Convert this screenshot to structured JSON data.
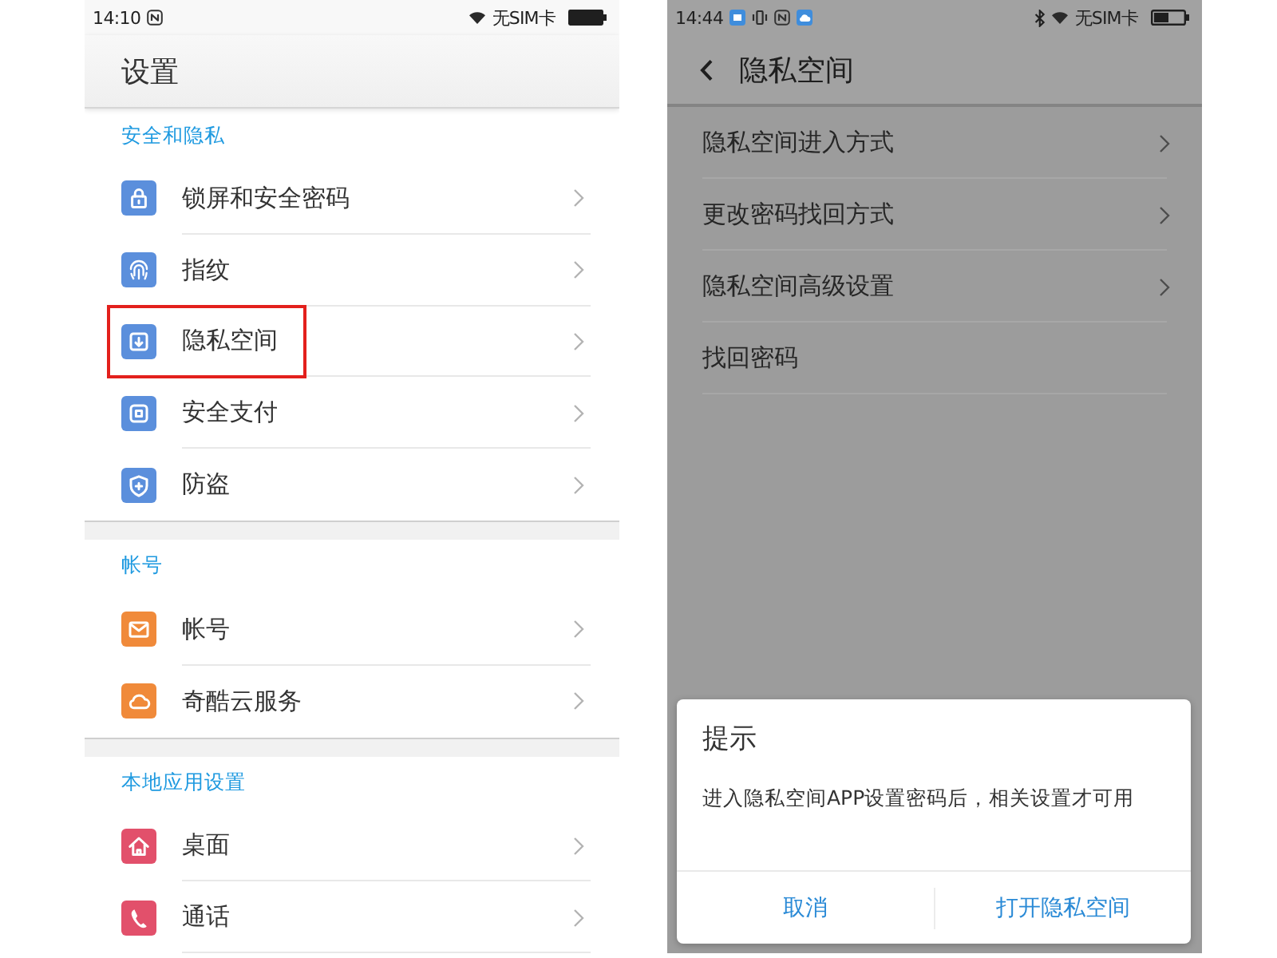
{
  "phones": [
    {
      "kind": "settings",
      "status_bar": {
        "time": "14:10",
        "carrier": "无SIM卡"
      },
      "title": "设置",
      "sections": [
        {
          "header": "安全和隐私",
          "items": [
            {
              "label": "锁屏和安全密码",
              "color": "#5b8fdc",
              "highlighted": false
            },
            {
              "label": "指纹",
              "color": "#5b8fdc",
              "highlighted": false
            },
            {
              "label": "隐私空间",
              "color": "#5b8fdc",
              "highlighted": true
            },
            {
              "label": "安全支付",
              "color": "#5b8fdc",
              "highlighted": false
            },
            {
              "label": "防盗",
              "color": "#5b8fdc",
              "highlighted": false
            }
          ]
        },
        {
          "header": "帐号",
          "items": [
            {
              "label": "帐号",
              "color": "#f08a3a",
              "highlighted": false
            },
            {
              "label": "奇酷云服务",
              "color": "#f08a3a",
              "highlighted": false
            }
          ]
        },
        {
          "header": "本地应用设置",
          "items": [
            {
              "label": "桌面",
              "color": "#e2506b",
              "highlighted": false
            },
            {
              "label": "通话",
              "color": "#e2506b",
              "highlighted": false
            }
          ]
        }
      ]
    },
    {
      "kind": "detail",
      "status_bar": {
        "time": "14:44",
        "carrier": "无SIM卡"
      },
      "title": "隐私空间",
      "items": [
        {
          "label": "隐私空间进入方式",
          "chevron": true
        },
        {
          "label": "更改密码找回方式",
          "chevron": true
        },
        {
          "label": "隐私空间高级设置",
          "chevron": true
        },
        {
          "label": "找回密码",
          "chevron": false
        }
      ],
      "dialog": {
        "title": "提示",
        "message": "进入隐私空间APP设置密码后，相关设置才可用",
        "buttons": [
          "取消",
          "打开隐私空间"
        ]
      }
    }
  ]
}
